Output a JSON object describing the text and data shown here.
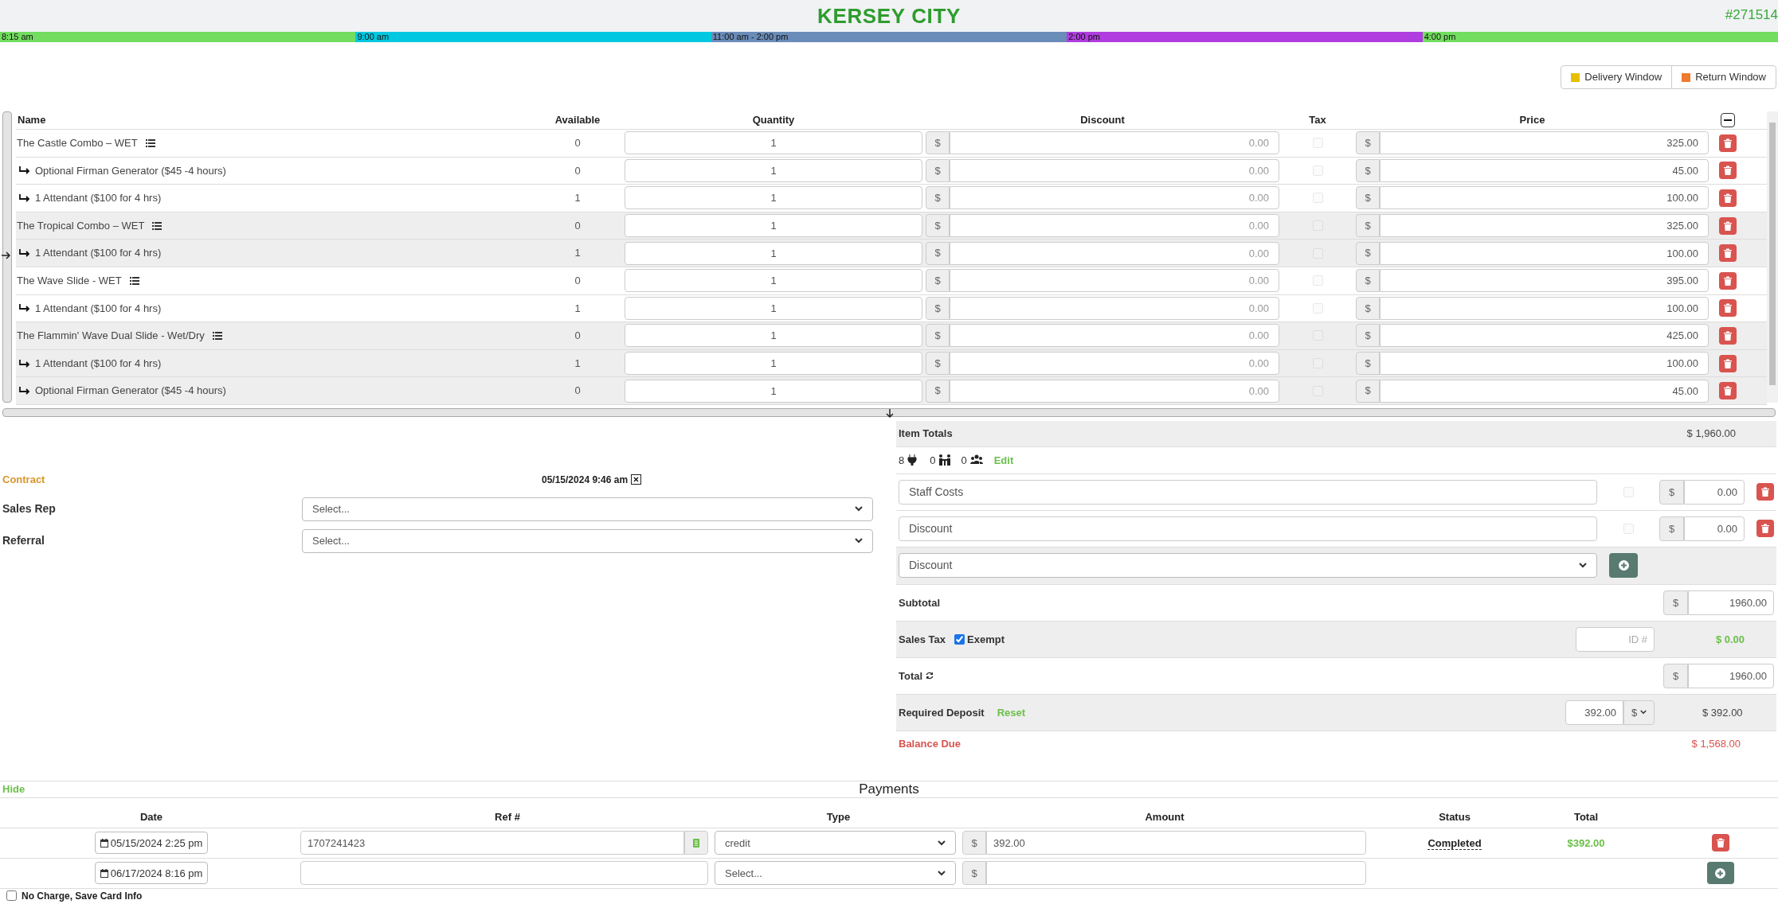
{
  "header": {
    "title": "KERSEY CITY",
    "order_number": "#271514"
  },
  "timeline": [
    {
      "label": "8:15 am",
      "color": "#72dd5f"
    },
    {
      "label": "9:00 am",
      "color": "#00c8e0"
    },
    {
      "label": "11:00 am - 2:00 pm",
      "color": "#6a8cb8"
    },
    {
      "label": "2:00 pm",
      "color": "#b03ddf"
    },
    {
      "label": "4:00 pm",
      "color": "#72dd5f"
    }
  ],
  "window_buttons": [
    {
      "label": "Delivery Window",
      "color": "#e6c000"
    },
    {
      "label": "Return Window",
      "color": "#f07a30"
    }
  ],
  "items_table": {
    "columns": [
      "Name",
      "Available",
      "Quantity",
      "Discount",
      "Tax",
      "Price"
    ],
    "groups": [
      {
        "name": "The Castle Combo – WET",
        "available": "0",
        "quantity": "1",
        "discount_symbol": "$",
        "discount": "0.00",
        "taxable": false,
        "price_symbol": "$",
        "price": "325.00",
        "children": [
          {
            "name": "Optional Firman Generator ($45 -4 hours)",
            "available": "0",
            "quantity": "1",
            "discount_symbol": "$",
            "discount": "0.00",
            "taxable": false,
            "price_symbol": "$",
            "price": "45.00"
          },
          {
            "name": "1 Attendant ($100 for 4 hrs)",
            "available": "1",
            "quantity": "1",
            "discount_symbol": "$",
            "discount": "0.00",
            "taxable": false,
            "price_symbol": "$",
            "price": "100.00"
          }
        ]
      },
      {
        "name": "The Tropical Combo – WET",
        "available": "0",
        "quantity": "1",
        "discount_symbol": "$",
        "discount": "0.00",
        "taxable": false,
        "price_symbol": "$",
        "price": "325.00",
        "children": [
          {
            "name": "1 Attendant ($100 for 4 hrs)",
            "available": "1",
            "quantity": "1",
            "discount_symbol": "$",
            "discount": "0.00",
            "taxable": false,
            "price_symbol": "$",
            "price": "100.00"
          }
        ]
      },
      {
        "name": "The Wave Slide - WET",
        "available": "0",
        "quantity": "1",
        "discount_symbol": "$",
        "discount": "0.00",
        "taxable": false,
        "price_symbol": "$",
        "price": "395.00",
        "children": [
          {
            "name": "1 Attendant ($100 for 4 hrs)",
            "available": "1",
            "quantity": "1",
            "discount_symbol": "$",
            "discount": "0.00",
            "taxable": false,
            "price_symbol": "$",
            "price": "100.00"
          }
        ]
      },
      {
        "name": "The Flammin' Wave Dual Slide - Wet/Dry",
        "available": "0",
        "quantity": "1",
        "discount_symbol": "$",
        "discount": "0.00",
        "taxable": false,
        "price_symbol": "$",
        "price": "425.00",
        "children": [
          {
            "name": "1 Attendant ($100 for 4 hrs)",
            "available": "1",
            "quantity": "1",
            "discount_symbol": "$",
            "discount": "0.00",
            "taxable": false,
            "price_symbol": "$",
            "price": "100.00"
          },
          {
            "name": "Optional Firman Generator ($45 -4 hours)",
            "available": "0",
            "quantity": "1",
            "discount_symbol": "$",
            "discount": "0.00",
            "taxable": false,
            "price_symbol": "$",
            "price": "45.00"
          }
        ]
      }
    ]
  },
  "contract": {
    "label": "Contract",
    "date": "05/15/2024 9:46 am",
    "fields": [
      {
        "label": "Sales Rep",
        "value": "Select..."
      },
      {
        "label": "Referral",
        "value": "Select..."
      }
    ]
  },
  "totals": {
    "item_totals": {
      "label": "Item Totals",
      "value": "$ 1,960.00"
    },
    "counts": [
      {
        "kind": "plug",
        "value": "8"
      },
      {
        "kind": "staff",
        "value": "0"
      },
      {
        "kind": "people",
        "value": "0"
      }
    ],
    "edit_link": "Edit",
    "fees": [
      {
        "name": "Staff Costs",
        "taxable": false,
        "symbol": "$",
        "amount": "0.00"
      },
      {
        "name": "Discount",
        "taxable": false,
        "symbol": "$",
        "amount": "0.00"
      }
    ],
    "add_fee_select": "Discount",
    "subtotal": {
      "label": "Subtotal",
      "symbol": "$",
      "value": "1960.00"
    },
    "sales_tax": {
      "label": "Sales Tax",
      "exempt_label": "Exempt",
      "exempt": true,
      "id_placeholder": "ID #",
      "value": "$ 0.00"
    },
    "total": {
      "label": "Total",
      "symbol": "$",
      "value": "1960.00"
    },
    "deposit": {
      "label": "Required Deposit",
      "reset": "Reset",
      "input": "392.00",
      "unit": "$",
      "value": "$ 392.00"
    },
    "balance_due": {
      "label": "Balance Due",
      "value": "$ 1,568.00"
    }
  },
  "payments": {
    "hide_link": "Hide",
    "title": "Payments",
    "columns": [
      "Date",
      "Ref #",
      "Type",
      "Amount",
      "Status",
      "Total"
    ],
    "rows": [
      {
        "kind": "existing",
        "date": "05/15/2024 2:25 pm",
        "ref": "1707241423",
        "type": "credit",
        "amount_symbol": "$",
        "amount": "392.00",
        "status": "Completed",
        "total": "$392.00"
      },
      {
        "kind": "new",
        "date": "06/17/2024 8:16 pm",
        "type": "Select...",
        "amount_symbol": "$"
      }
    ],
    "no_charge": {
      "label": "No Charge, Save Card Info",
      "checked": false
    }
  }
}
